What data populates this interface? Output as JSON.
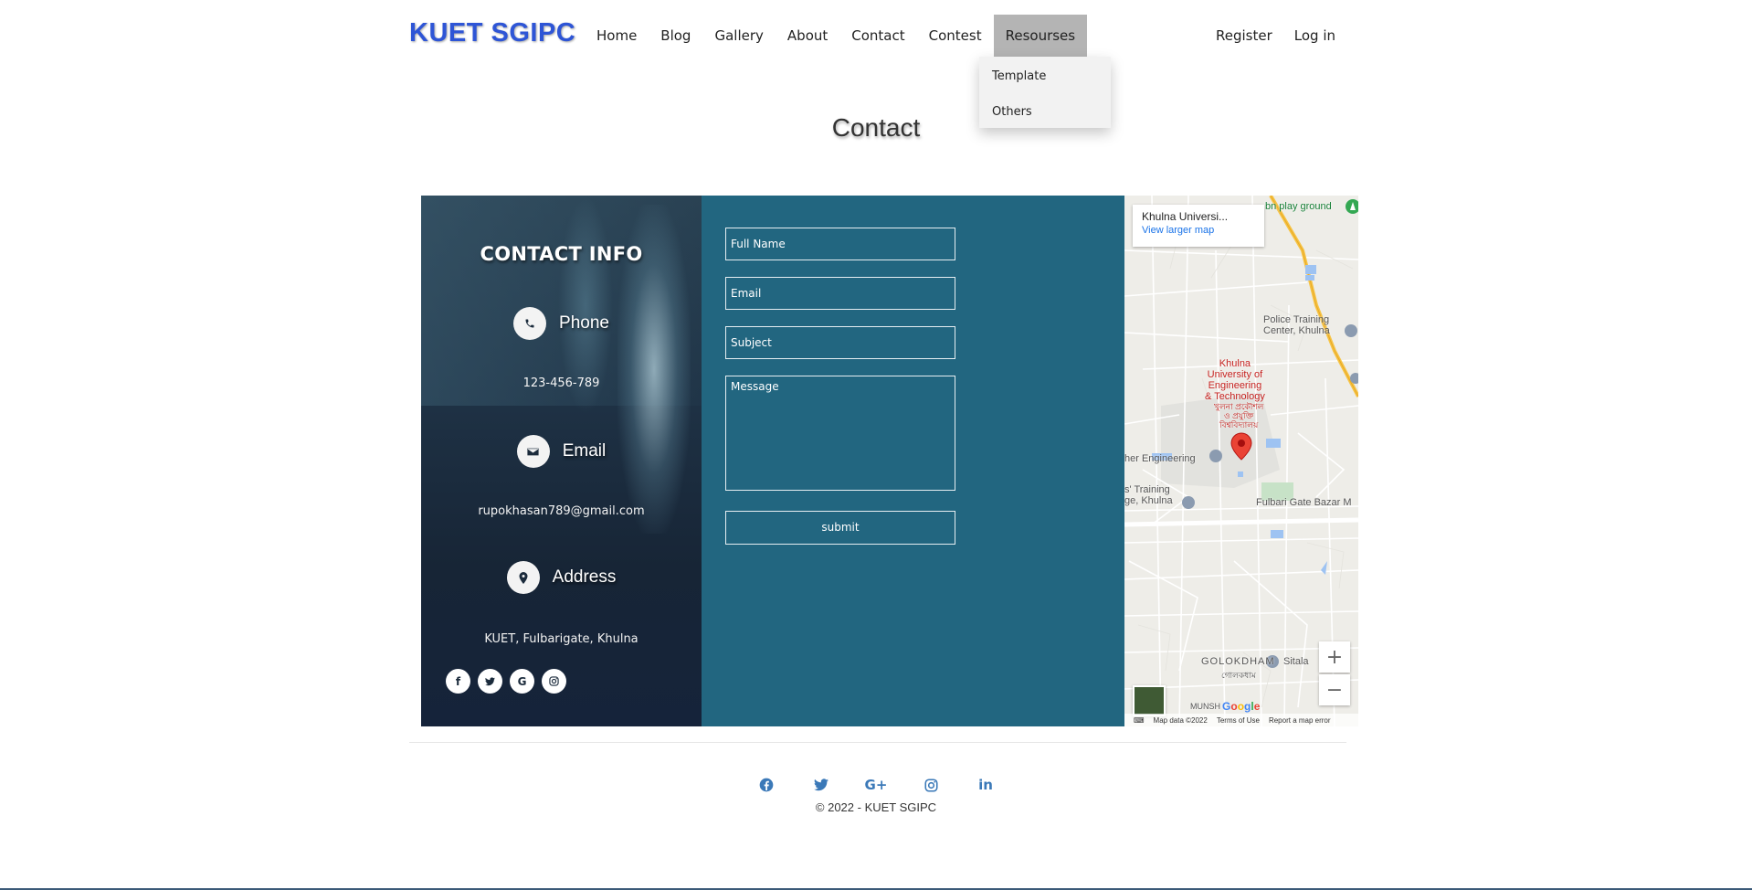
{
  "nav": {
    "brand": "KUET SGIPC",
    "links": [
      "Home",
      "Blog",
      "Gallery",
      "About",
      "Contact",
      "Contest",
      "Resourses"
    ],
    "right": [
      "Register",
      "Log in"
    ],
    "dropdown": [
      "Template",
      "Others"
    ]
  },
  "page_title": "Contact",
  "contact_info": {
    "title": "CONTACT INFO",
    "phone_label": "Phone",
    "phone_value": "123-456-789",
    "email_label": "Email",
    "email_value": "rupokhasan789@gmail.com",
    "address_label": "Address",
    "address_value": "KUET, Fulbarigate, Khulna",
    "socials": [
      "facebook-icon",
      "twitter-icon",
      "google-icon",
      "instagram-icon"
    ]
  },
  "form": {
    "full_name": "Full Name",
    "email": "Email",
    "subject": "Subject",
    "message": "Message",
    "submit": "submit"
  },
  "map": {
    "place_name": "Khulna Universi...",
    "view_larger": "View larger map",
    "labels": {
      "playground": "bn play ground",
      "police": "Police Training\nCenter, Khulna",
      "kuet": "Khulna\nUniversity of\nEngineering\n& Technology",
      "kuet_bn": "খুলনা প্রকৌশল\nও প্রযুক্তি\nবিশ্ববিদ্যালয়",
      "engineering": "her Engineering",
      "training": "s' Training\nge, Khulna",
      "fulbari": "Fulbari Gate Bazar M",
      "golokdham": "GOLOKDHAM",
      "golokdham_bn": "গোলকধাম",
      "sitala": "Sitala",
      "munsh": "MUNSH"
    },
    "zoom_in": "+",
    "zoom_out": "−",
    "google": "Google",
    "attribution": [
      "Map data ©2022",
      "Terms of Use",
      "Report a map error"
    ]
  },
  "footer": {
    "icons": [
      "facebook-icon",
      "twitter-icon",
      "google-plus-icon",
      "instagram-icon",
      "linkedin-icon"
    ],
    "copyright": "© 2022 - KUET SGIPC"
  },
  "colors": {
    "brand": "#2e55d6",
    "form_bg": "#226680",
    "info_bg": "#172536",
    "footer_icon": "#3b79b8"
  }
}
